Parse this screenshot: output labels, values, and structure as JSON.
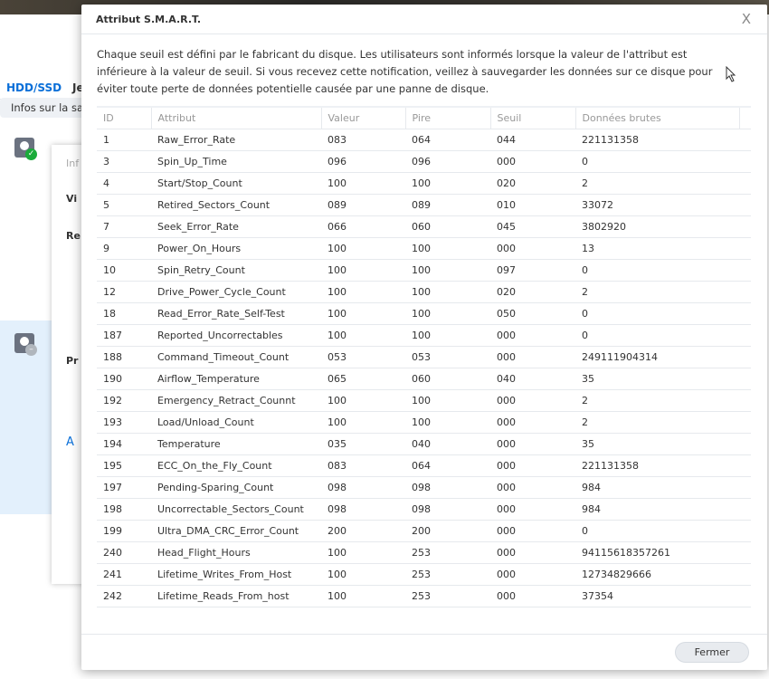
{
  "background": {
    "tabs": [
      {
        "label": "HDD/SSD"
      },
      {
        "label": "Je"
      }
    ],
    "infobar": "Infos sur la sa",
    "subdialog": [
      "Inf",
      "Vi",
      "Re",
      "Pr",
      "A"
    ]
  },
  "dialog": {
    "title": "Attribut S.M.A.R.T.",
    "close_label": "X",
    "description": "Chaque seuil est défini par le fabricant du disque. Les utilisateurs sont informés lorsque la valeur de l'attribut est inférieure à la valeur de seuil. Si vous recevez cette notification, veillez à sauvegarder les données sur ce disque pour éviter toute perte de données potentielle causée par une panne de disque.",
    "columns": [
      "ID",
      "Attribut",
      "Valeur",
      "Pire",
      "Seuil",
      "Données brutes"
    ],
    "rows": [
      [
        "1",
        "Raw_Error_Rate",
        "083",
        "064",
        "044",
        "221131358"
      ],
      [
        "3",
        "Spin_Up_Time",
        "096",
        "096",
        "000",
        "0"
      ],
      [
        "4",
        "Start/Stop_Count",
        "100",
        "100",
        "020",
        "2"
      ],
      [
        "5",
        "Retired_Sectors_Count",
        "089",
        "089",
        "010",
        "33072"
      ],
      [
        "7",
        "Seek_Error_Rate",
        "066",
        "060",
        "045",
        "3802920"
      ],
      [
        "9",
        "Power_On_Hours",
        "100",
        "100",
        "000",
        "13"
      ],
      [
        "10",
        "Spin_Retry_Count",
        "100",
        "100",
        "097",
        "0"
      ],
      [
        "12",
        "Drive_Power_Cycle_Count",
        "100",
        "100",
        "020",
        "2"
      ],
      [
        "18",
        "Read_Error_Rate_Self-Test",
        "100",
        "100",
        "050",
        "0"
      ],
      [
        "187",
        "Reported_Uncorrectables",
        "100",
        "100",
        "000",
        "0"
      ],
      [
        "188",
        "Command_Timeout_Count",
        "053",
        "053",
        "000",
        "249111904314"
      ],
      [
        "190",
        "Airflow_Temperature",
        "065",
        "060",
        "040",
        "35"
      ],
      [
        "192",
        "Emergency_Retract_Counnt",
        "100",
        "100",
        "000",
        "2"
      ],
      [
        "193",
        "Load/Unload_Count",
        "100",
        "100",
        "000",
        "2"
      ],
      [
        "194",
        "Temperature",
        "035",
        "040",
        "000",
        "35"
      ],
      [
        "195",
        "ECC_On_the_Fly_Count",
        "083",
        "064",
        "000",
        "221131358"
      ],
      [
        "197",
        "Pending-Sparing_Count",
        "098",
        "098",
        "000",
        "984"
      ],
      [
        "198",
        "Uncorrectable_Sectors_Count",
        "098",
        "098",
        "000",
        "984"
      ],
      [
        "199",
        "Ultra_DMA_CRC_Error_Count",
        "200",
        "200",
        "000",
        "0"
      ],
      [
        "240",
        "Head_Flight_Hours",
        "100",
        "253",
        "000",
        "94115618357261"
      ],
      [
        "241",
        "Lifetime_Writes_From_Host",
        "100",
        "253",
        "000",
        "12734829666"
      ],
      [
        "242",
        "Lifetime_Reads_From_host",
        "100",
        "253",
        "000",
        "37354"
      ]
    ],
    "close_button": "Fermer"
  },
  "colors": {
    "accent": "#0a6fd8",
    "status_ok": "#1aab3a",
    "selected_row": "#e3f0fc"
  }
}
